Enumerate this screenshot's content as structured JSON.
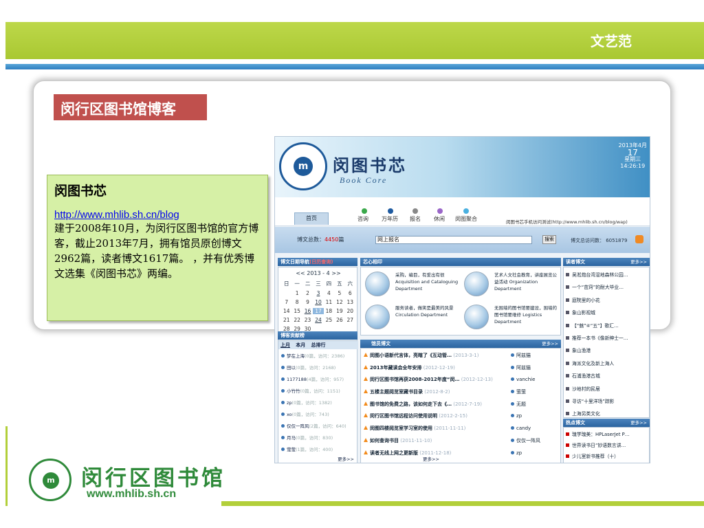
{
  "header": {
    "title": "文艺范"
  },
  "card": {
    "title": "闵行区图书馆博客",
    "box_title": "闵图书芯",
    "url": "http://www.mhlib.sh.cn/blog",
    "description": "建于2008年10月，为闵行区图书馆的官方博客，截止2013年7月，拥有馆员原创博文2962篇，读者博文1617篇。 ，并有优秀博文选集《闵图书芯》两编。"
  },
  "screenshot": {
    "banner": {
      "title": "闵图书芯",
      "subtitle": "Book Core",
      "date_month": "2013年4月",
      "date_day": "17",
      "date_weekday": "星期三",
      "date_time": "14:26:19",
      "seal_text": "m"
    },
    "nav": {
      "home": "首页",
      "items": [
        {
          "label": "咨询",
          "color": "#3aa84a"
        },
        {
          "label": "万年历",
          "color": "#1e5aa0"
        },
        {
          "label": "报名",
          "color": "#888888"
        },
        {
          "label": "休闲",
          "color": "#9a66c8"
        },
        {
          "label": "闵图聚合",
          "color": "#4ab0e0"
        }
      ],
      "mobile_link": "闵图书芯手机访问测试(http://www.mhlib.sh.cn/blog/wap)"
    },
    "stats": {
      "total_label": "博文总数：",
      "total_value": "4450",
      "total_unit": "篇",
      "search_value": "网上报名",
      "search_button": "搜索",
      "visits": "博文总访问数： 6051879"
    },
    "calendar": {
      "header": "博文日期导航",
      "header_tag": "(日历查询)",
      "title": "<< 2013 - 4 >>",
      "weekdays": [
        "日",
        "一",
        "二",
        "三",
        "四",
        "五",
        "六"
      ],
      "days": [
        "",
        "1",
        "2",
        "3",
        "4",
        "5",
        "6",
        "7",
        "8",
        "9",
        "10",
        "11",
        "12",
        "13",
        "14",
        "15",
        "16",
        "17",
        "18",
        "19",
        "20",
        "21",
        "22",
        "23",
        "24",
        "25",
        "26",
        "27",
        "28",
        "29",
        "30",
        "",
        "",
        "",
        ""
      ]
    },
    "contrib": {
      "header": "博客贡献榜",
      "tabs": [
        "上月",
        "本月",
        "总排行"
      ],
      "items": [
        {
          "name": "梦在上海",
          "note": "(0篇，访问：2386)"
        },
        {
          "name": "田以",
          "note": "(0篇，访问：2168)"
        },
        {
          "name": "1177188",
          "note": "(4篇，访问：957)"
        },
        {
          "name": "小竹竹",
          "note": "(0篇，访问：1151)"
        },
        {
          "name": "zp",
          "note": "(0篇，访问：1382)"
        },
        {
          "name": "xo",
          "note": "(0篇，访问：743)"
        },
        {
          "name": "仅仅一阵风",
          "note": "(2篇，访问：640)"
        },
        {
          "name": "月马",
          "note": "(0篇，访问：830)"
        },
        {
          "name": "萤萤",
          "note": "(1篇，访问：400)"
        }
      ],
      "more": "更多>>"
    },
    "xinxiang": {
      "header": "芯心相印",
      "cells": [
        {
          "text": "采购，编目，有爱出有很 Acquisition and Cataloguing Department"
        },
        {
          "text": "艺术人文社会教育，讲座展览公益活动 Organization Department"
        },
        {
          "text": "服务读者，做笑是最美的风景 Circulation Department"
        },
        {
          "text": "无围墙的图书馆要建设，围墙的图书馆要维修 Logistics Department"
        }
      ]
    },
    "latest": {
      "header": "馆员博文",
      "more": "更多>>",
      "rows": [
        {
          "title": "闵图小语新代言体，亮瞎了《互动管…",
          "date": "(2013-3-1)",
          "author": "阿兹猫"
        },
        {
          "title": "2013年藏读会全年安排",
          "date": "(2012-12-19)",
          "author": "阿兹猫"
        },
        {
          "title": "闵行区图书馆再获2008-2012年度“闵…",
          "date": "(2012-12-13)",
          "author": "vanchie"
        },
        {
          "title": "五楼主题阅览室藏书目录",
          "date": "(2012-8-2)",
          "author": "萤萤"
        },
        {
          "title": "图书馆的免费之路，该如何走下去《…",
          "date": "(2012-7-19)",
          "author": "无题"
        },
        {
          "title": "闵行区图书馆远程访问使用说明",
          "date": "(2012-2-15)",
          "author": "zp"
        },
        {
          "title": "闵图四楼阅览室学习室的使用",
          "date": "(2011-11-11)",
          "author": "candy"
        },
        {
          "title": "如何查询书目",
          "date": "(2011-11-10)",
          "author": "仅仅一阵风"
        },
        {
          "title": "读者无线上网之更新版",
          "date": "(2011-12-18)",
          "author": "zp"
        }
      ],
      "more_bottom": "更多>>"
    },
    "readers": {
      "header": "读者博文",
      "more": "更多>>",
      "items": [
        "吴淞炮台湾湿地森林公园…",
        "一个“茁窍”的耐大毕业…",
        "庭院里的小花",
        "象山影视城",
        "【“魅”④“五”】歌汇…",
        "推荐一本书《像新绅士一…",
        "象山渔港",
        "海派文化及新上海人",
        "石浦渔港古城",
        "沙地村的民居",
        "寻访“十里洋场”踪影",
        "上海另类文化"
      ]
    },
    "hot": {
      "header": "热点博文",
      "more": "更多>>",
      "items": [
        "瑰学瑰美：HPLaserJet P…",
        "世界读书日“妙语数言讲…",
        "少儿室新书推荐（十）"
      ]
    }
  },
  "footer": {
    "seal_text": "m",
    "name": "闵行区图书馆",
    "url": "www.mhlib.sh.cn"
  }
}
